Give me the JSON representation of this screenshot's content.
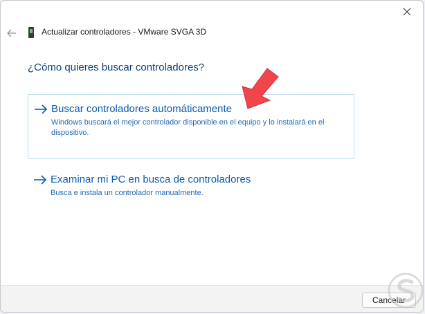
{
  "window": {
    "title": "Actualizar controladores - VMware SVGA 3D",
    "close_icon": "close-icon",
    "back_icon": "back-arrow-icon",
    "device_icon": "device-icon"
  },
  "main": {
    "question": "¿Cómo quieres buscar controladores?",
    "options": [
      {
        "title": "Buscar controladores automáticamente",
        "description": "Windows buscará el mejor controlador disponible en el equipo y lo instalará en el dispositivo.",
        "icon": "arrow-right-icon"
      },
      {
        "title": "Examinar mi PC en busca de controladores",
        "description": "Busca e instala un controlador manualmente.",
        "icon": "arrow-right-icon"
      }
    ]
  },
  "footer": {
    "cancel_label": "Cancelar"
  },
  "colors": {
    "link": "#0c5bb0",
    "question": "#0d3d75",
    "annotation_arrow": "#f0454a"
  }
}
